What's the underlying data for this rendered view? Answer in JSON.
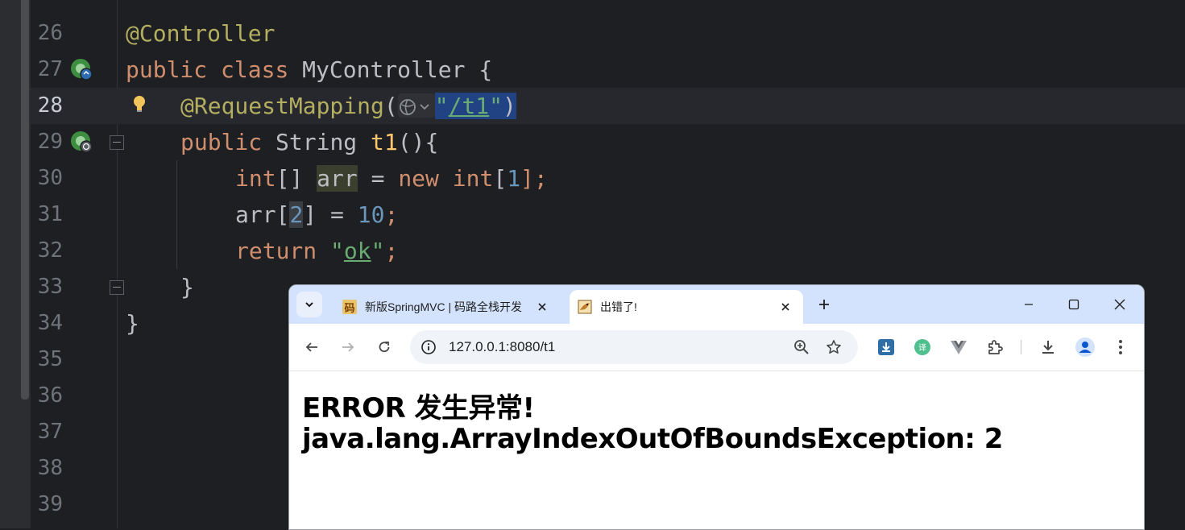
{
  "ide": {
    "line_numbers": [
      "26",
      "27",
      "28",
      "29",
      "30",
      "31",
      "32",
      "33",
      "34",
      "35",
      "36",
      "37",
      "38",
      "39"
    ],
    "code": {
      "l26": "@Controller",
      "l27_kw1": "public",
      "l27_kw2": "class",
      "l27_name": "MyController",
      "l27_brace": "{",
      "l28_ann": "@RequestMapping",
      "l28_open": "(",
      "l28_q1": "\"",
      "l28_path": "/t1",
      "l28_q2": "\"",
      "l28_close": ")",
      "l29_kw": "public",
      "l29_type": "String",
      "l29_name": "t1",
      "l29_rest": "(){",
      "l30_type": "int",
      "l30_brackets": "[]",
      "l30_var": "arr",
      "l30_eq": "=",
      "l30_new": "new",
      "l30_type2": "int",
      "l30_open": "[",
      "l30_num": "1",
      "l30_close": "];",
      "l31_var": "arr",
      "l31_open": "[",
      "l31_idx": "2",
      "l31_close": "]",
      "l31_eq": "=",
      "l31_num": "10",
      "l31_semi": ";",
      "l32_kw": "return",
      "l32_q1": "\"",
      "l32_str": "ok",
      "l32_q2": "\"",
      "l32_semi": ";",
      "l33": "}",
      "l34": "}"
    },
    "icons": {
      "bean": "spring-bean-icon",
      "bulb": "lightbulb-icon",
      "globe": "globe-icon",
      "fold": "fold-icon"
    }
  },
  "browser": {
    "tabs": [
      {
        "title": "新版SpringMVC | 码路全栈开发",
        "favicon": "码",
        "active": false
      },
      {
        "title": "出错了!",
        "favicon": "🦊",
        "active": true
      }
    ],
    "url": "127.0.0.1:8080/t1",
    "heading1": "ERROR 发生异常!",
    "heading2": "java.lang.ArrayIndexOutOfBoundsException: 2",
    "colors": {
      "tabbar": "#d3e3fd",
      "omnibox": "#f0f4f9"
    }
  }
}
